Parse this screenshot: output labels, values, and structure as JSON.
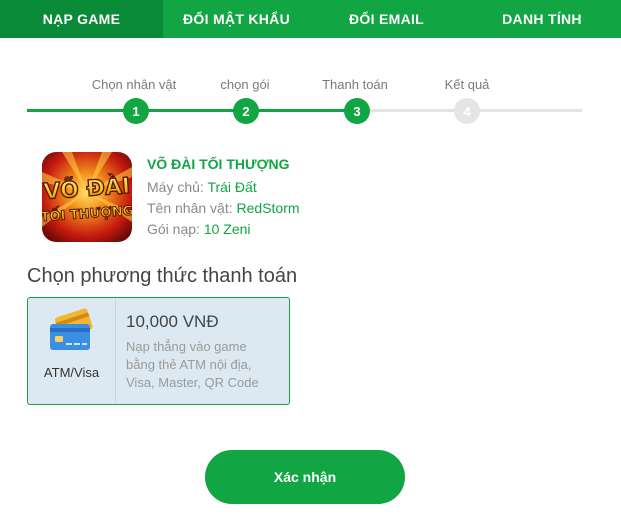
{
  "tabs": [
    {
      "label": "NẠP GAME",
      "active": true
    },
    {
      "label": "ĐỔI MẬT KHẨU",
      "active": false
    },
    {
      "label": "ĐỔI EMAIL",
      "active": false
    },
    {
      "label": "DANH TÍNH",
      "active": false
    }
  ],
  "stepper": {
    "steps": [
      {
        "label": "Chọn nhân vật",
        "number": "1",
        "status": "done"
      },
      {
        "label": "chọn gói",
        "number": "2",
        "status": "done"
      },
      {
        "label": "Thanh toán",
        "number": "3",
        "status": "current"
      },
      {
        "label": "Kết quả",
        "number": "4",
        "status": "pending"
      }
    ]
  },
  "game": {
    "logo_text_line1": "VÕ ĐÀI",
    "logo_text_line2": "TỐI THƯỢNG",
    "title": "VÕ ĐÀI TỐI THƯỢNG",
    "server_label": "Máy chủ:",
    "server_value": "Trái Đất",
    "character_label": "Tên nhân vật:",
    "character_value": "RedStorm",
    "package_label": "Gói nạp:",
    "package_value": "10 Zeni"
  },
  "payment": {
    "section_title": "Chọn phương thức thanh toán",
    "method_label": "ATM/Visa",
    "method_icon": "credit-card-icon",
    "price": "10,000 VNĐ",
    "description": "Nạp thẳng vào game bằng thẻ ATM nội địa, Visa, Master, QR Code"
  },
  "confirm_label": "Xác nhận",
  "colors": {
    "primary": "#11a544",
    "primary_dark": "#088a36",
    "card_bg": "#dce9f3",
    "inactive_step": "#e5e5e5"
  }
}
